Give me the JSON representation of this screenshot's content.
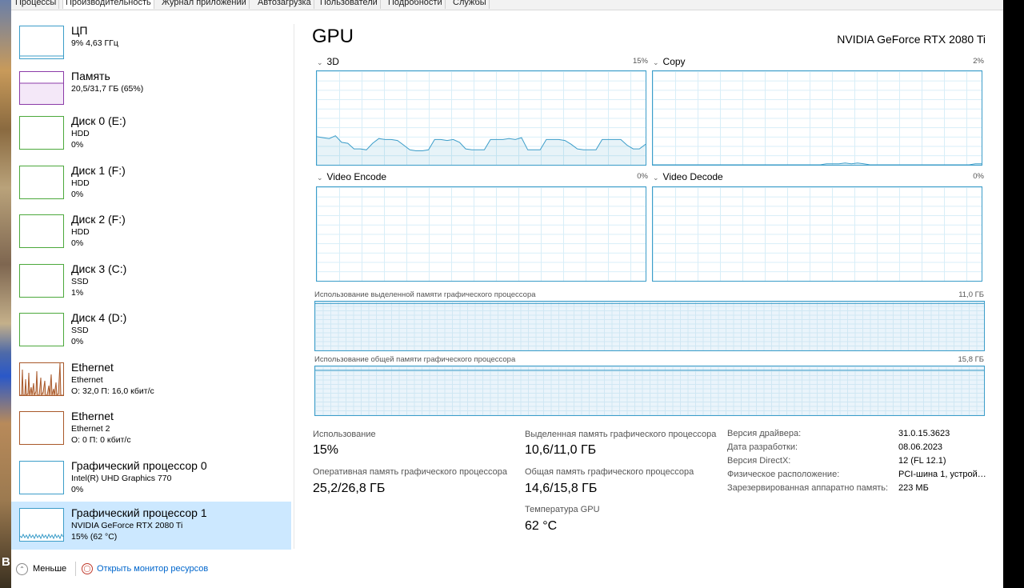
{
  "wallpaper_glyph": "B",
  "tabs": [
    "Процессы",
    "Производительность",
    "Журнал приложений",
    "Автозагрузка",
    "Пользователи",
    "Подробности",
    "Службы"
  ],
  "sidebar": {
    "items": [
      {
        "title": "ЦП",
        "line1": "9% 4,63 ГГц",
        "line2": "",
        "kind": "cpu"
      },
      {
        "title": "Память",
        "line1": "20,5/31,7 ГБ (65%)",
        "line2": "",
        "kind": "mem"
      },
      {
        "title": "Диск 0 (E:)",
        "line1": "HDD",
        "line2": "0%",
        "kind": "disk"
      },
      {
        "title": "Диск 1 (F:)",
        "line1": "HDD",
        "line2": "0%",
        "kind": "disk"
      },
      {
        "title": "Диск 2 (F:)",
        "line1": "HDD",
        "line2": "0%",
        "kind": "disk"
      },
      {
        "title": "Диск 3 (C:)",
        "line1": "SSD",
        "line2": "1%",
        "kind": "disk"
      },
      {
        "title": "Диск 4 (D:)",
        "line1": "SSD",
        "line2": "0%",
        "kind": "disk"
      },
      {
        "title": "Ethernet",
        "line1": "Ethernet",
        "line2": "О: 32,0 П: 16,0 кбит/с",
        "kind": "net"
      },
      {
        "title": "Ethernet",
        "line1": "Ethernet 2",
        "line2": "О: 0 П: 0 кбит/с",
        "kind": "net"
      },
      {
        "title": "Графический процессор 0",
        "line1": "Intel(R) UHD Graphics 770",
        "line2": "0%",
        "kind": "gpu"
      },
      {
        "title": "Графический процессор 1",
        "line1": "NVIDIA GeForce RTX 2080 Ti",
        "line2": "15% (62 °C)",
        "kind": "gpu",
        "selected": true
      }
    ]
  },
  "main": {
    "heading": "GPU",
    "model": "NVIDIA GeForce RTX 2080 Ti",
    "engines": [
      {
        "label": "3D",
        "percent": "15%",
        "trace": [
          30,
          29,
          28,
          31,
          24,
          23,
          17,
          17,
          16,
          23,
          28,
          27,
          27,
          26,
          21,
          16,
          15,
          15,
          16,
          27,
          27,
          26,
          27,
          24,
          17,
          16,
          16,
          16,
          27,
          27,
          27,
          28,
          27,
          29,
          16,
          16,
          16,
          27,
          27,
          27,
          26,
          22,
          17,
          16,
          16,
          16,
          27,
          27,
          27,
          27,
          21,
          17,
          17,
          22
        ]
      },
      {
        "label": "Copy",
        "percent": "2%",
        "trace": [
          0,
          0,
          0,
          0,
          0,
          0,
          0,
          0,
          0,
          0,
          0,
          0,
          0,
          0,
          0,
          0,
          0,
          0,
          0,
          0,
          0,
          0,
          0,
          0,
          0,
          0,
          0,
          0,
          1,
          1,
          1,
          2,
          1,
          2,
          1,
          0,
          0,
          0,
          0,
          0,
          0,
          0,
          0,
          0,
          0,
          0,
          0,
          0,
          0,
          0,
          0,
          0,
          1,
          1
        ]
      },
      {
        "label": "Video Encode",
        "percent": "0%",
        "trace": []
      },
      {
        "label": "Video Decode",
        "percent": "0%",
        "trace": []
      }
    ],
    "dedicated_memory": {
      "label": "Использование выделенной памяти графического процессора",
      "max": "11,0 ГБ",
      "usage": 0.96
    },
    "shared_memory": {
      "label": "Использование общей памяти графического процессора",
      "max": "15,8 ГБ",
      "usage": 0.92
    },
    "stats": {
      "utilization": {
        "label": "Использование",
        "value": "15%"
      },
      "gpu_memory": {
        "label": "Оперативная память графического процессора",
        "value": "25,2/26,8 ГБ"
      },
      "dedicated": {
        "label": "Выделенная память графического процессора",
        "value": "10,6/11,0 ГБ"
      },
      "shared": {
        "label": "Общая память графического процессора",
        "value": "14,6/15,8 ГБ"
      },
      "temperature": {
        "label": "Температура GPU",
        "value": "62 °C"
      }
    },
    "properties": [
      {
        "label": "Версия драйвера:",
        "value": "31.0.15.3623"
      },
      {
        "label": "Дата разработки:",
        "value": "08.06.2023"
      },
      {
        "label": "Версия DirectX:",
        "value": "12 (FL 12.1)"
      },
      {
        "label": "Физическое расположение:",
        "value": "PCI-шина 1, устрой…"
      },
      {
        "label": "Зарезервированная аппаратно память:",
        "value": "223 МБ"
      }
    ]
  },
  "footer": {
    "less_label": "Меньше",
    "monitor_label": "Открыть монитор ресурсов"
  },
  "colors": {
    "cpu": "#3c9dc9",
    "mem": "#8b3ba8",
    "disk": "#4ca83c",
    "net": "#a8582a",
    "gpu": "#3c9dc9"
  }
}
